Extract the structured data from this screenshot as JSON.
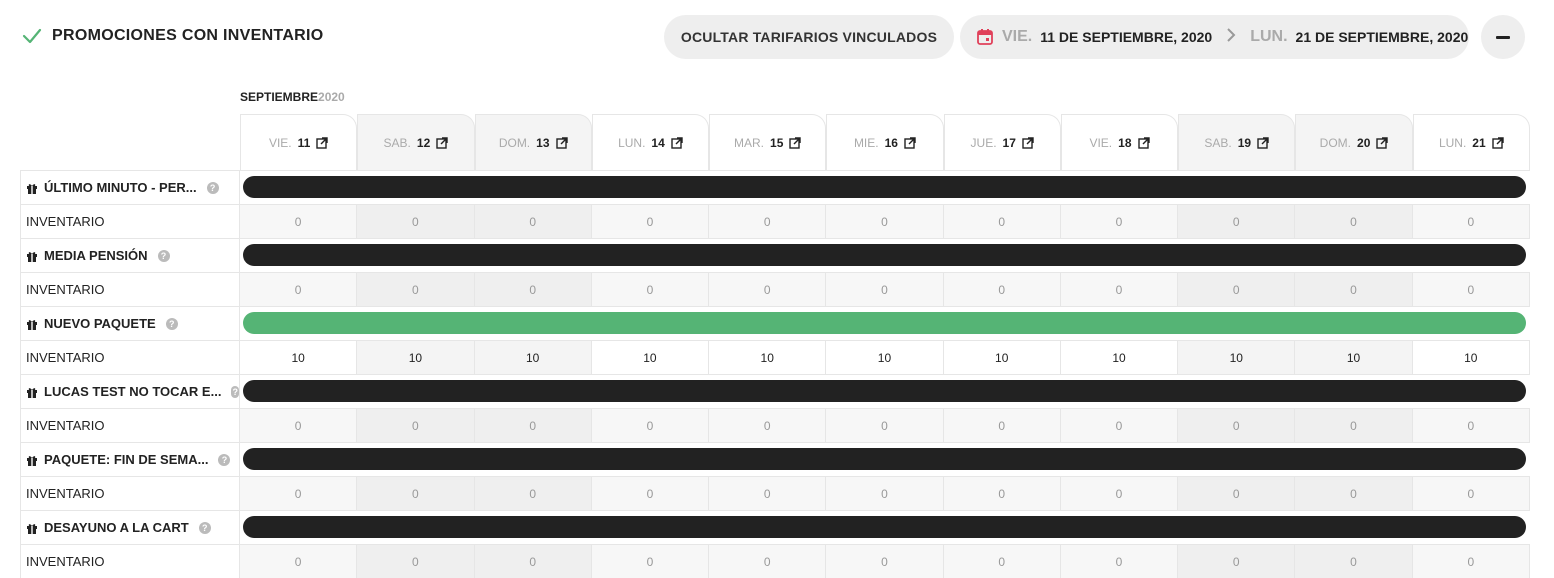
{
  "header": {
    "title": "PROMOCIONES CON INVENTARIO",
    "check_icon": "check-icon",
    "hide_button": "OCULTAR TARIFARIOS VINCULADOS",
    "date_range": {
      "from_dow": "VIE.",
      "from_date": "11 DE SEPTIEMBRE, 2020",
      "to_dow": "LUN.",
      "to_date": "21 DE SEPTIEMBRE, 2020"
    },
    "accent_color": "#e0405a"
  },
  "calendar": {
    "month": "SEPTIEMBRE",
    "year": "2020",
    "days": [
      {
        "dow": "VIE.",
        "num": "11",
        "weekend": false
      },
      {
        "dow": "SAB.",
        "num": "12",
        "weekend": true
      },
      {
        "dow": "DOM.",
        "num": "13",
        "weekend": true
      },
      {
        "dow": "LUN.",
        "num": "14",
        "weekend": false
      },
      {
        "dow": "MAR.",
        "num": "15",
        "weekend": false
      },
      {
        "dow": "MIE.",
        "num": "16",
        "weekend": false
      },
      {
        "dow": "JUE.",
        "num": "17",
        "weekend": false
      },
      {
        "dow": "VIE.",
        "num": "18",
        "weekend": false
      },
      {
        "dow": "SAB.",
        "num": "19",
        "weekend": true
      },
      {
        "dow": "DOM.",
        "num": "20",
        "weekend": true
      },
      {
        "dow": "LUN.",
        "num": "21",
        "weekend": false
      }
    ]
  },
  "inventory_label": "INVENTARIO",
  "help_glyph": "?",
  "status_colors": {
    "inactive": "#222222",
    "active": "#55b475"
  },
  "promotions": [
    {
      "name": "ÚLTIMO MINUTO - PER...",
      "status": "inactive",
      "inventory": [
        "0",
        "0",
        "0",
        "0",
        "0",
        "0",
        "0",
        "0",
        "0",
        "0",
        "0"
      ]
    },
    {
      "name": "MEDIA PENSIÓN",
      "status": "inactive",
      "inventory": [
        "0",
        "0",
        "0",
        "0",
        "0",
        "0",
        "0",
        "0",
        "0",
        "0",
        "0"
      ]
    },
    {
      "name": "NUEVO PAQUETE",
      "status": "active",
      "inventory": [
        "10",
        "10",
        "10",
        "10",
        "10",
        "10",
        "10",
        "10",
        "10",
        "10",
        "10"
      ]
    },
    {
      "name": "LUCAS TEST NO TOCAR E...",
      "status": "inactive",
      "inventory": [
        "0",
        "0",
        "0",
        "0",
        "0",
        "0",
        "0",
        "0",
        "0",
        "0",
        "0"
      ]
    },
    {
      "name": "PAQUETE: FIN DE SEMA...",
      "status": "inactive",
      "inventory": [
        "0",
        "0",
        "0",
        "0",
        "0",
        "0",
        "0",
        "0",
        "0",
        "0",
        "0"
      ]
    },
    {
      "name": "DESAYUNO A LA CART",
      "status": "inactive",
      "inventory": [
        "0",
        "0",
        "0",
        "0",
        "0",
        "0",
        "0",
        "0",
        "0",
        "0",
        "0"
      ]
    }
  ]
}
